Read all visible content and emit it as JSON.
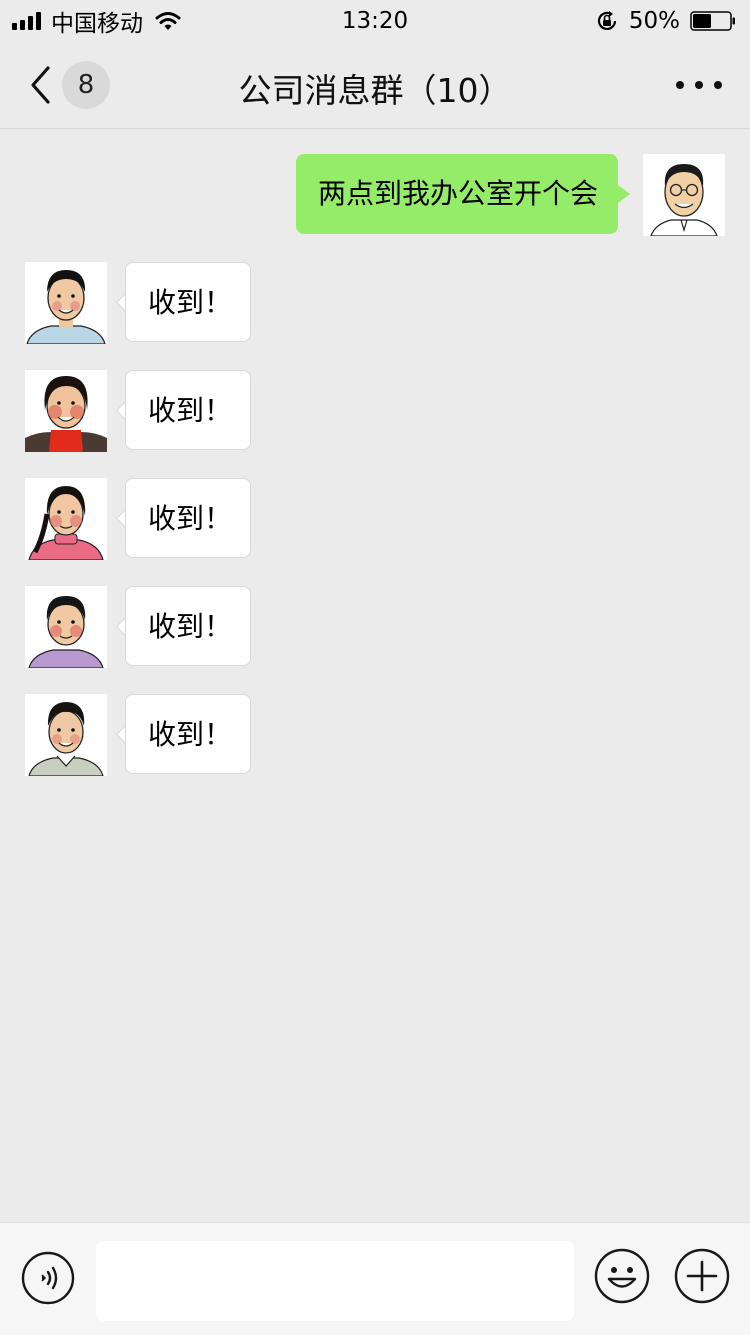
{
  "status_bar": {
    "carrier": "中国移动",
    "time": "13:20",
    "battery_percent": "50%",
    "battery_level": 0.5,
    "signal_bars": 4
  },
  "nav": {
    "unread_count": "8",
    "title": "公司消息群（10）"
  },
  "messages": [
    {
      "direction": "outgoing",
      "text": "两点到我办公室开个会",
      "avatar": "man-with-glasses"
    },
    {
      "direction": "incoming",
      "text": "收到！",
      "avatar": "man-light-blue-shirt"
    },
    {
      "direction": "incoming",
      "text": "收到！",
      "avatar": "woman-red-sweater"
    },
    {
      "direction": "incoming",
      "text": "收到！",
      "avatar": "woman-pink-sweater"
    },
    {
      "direction": "incoming",
      "text": "收到！",
      "avatar": "woman-purple-shirt"
    },
    {
      "direction": "incoming",
      "text": "收到！",
      "avatar": "man-collared-shirt"
    }
  ],
  "input_bar": {
    "message_value": "",
    "voice_icon": "voice-icon",
    "emoji_icon": "emoji-icon",
    "plus_icon": "plus-icon"
  },
  "colors": {
    "background": "#ebebeb",
    "outgoing_bubble": "#95ec69",
    "incoming_bubble": "#ffffff"
  }
}
